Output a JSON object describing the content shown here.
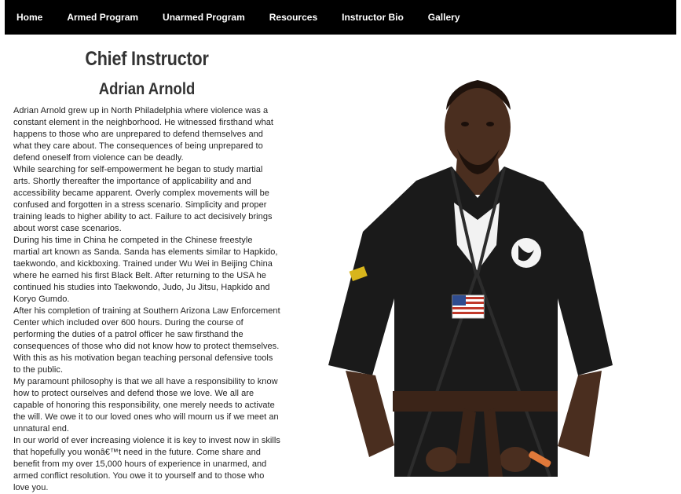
{
  "nav": {
    "items": [
      {
        "label": "Home"
      },
      {
        "label": "Armed Program"
      },
      {
        "label": "Unarmed Program"
      },
      {
        "label": "Resources"
      },
      {
        "label": "Instructor Bio"
      },
      {
        "label": "Gallery"
      }
    ]
  },
  "header": {
    "title": "Chief Instructor",
    "name": "Adrian Arnold"
  },
  "bio": {
    "paragraphs": [
      "Adrian Arnold grew up in North Philadelphia where violence was a constant element in the neighborhood. He witnessed firsthand what happens to those who are unprepared to defend themselves and what they care about. The consequences of being unprepared to defend oneself from violence can be deadly.",
      "While searching for self-empowerment he began to study martial arts. Shortly thereafter the importance of applicability and and accessibility became apparent. Overly complex movements will be confused and forgotten in a stress scenario. Simplicity and proper training leads to higher ability to act. Failure to act decisively brings about worst case scenarios.",
      "During his time in China he competed in the Chinese freestyle martial art known as Sanda. Sanda has elements similar to Hapkido, taekwondo, and kickboxing. Trained under Wu Wei in Beijing China where he earned his first Black Belt. After returning to the USA he continued his studies into Taekwondo, Judo, Ju Jitsu, Hapkido and Koryo Gumdo.",
      "After his completion of training at Southern Arizona Law Enforcement Center which included over 600 hours. During the course of performing the duties of a patrol officer he saw firsthand the consequences of those who did not know how to protect themselves. With this as his motivation began teaching personal defensive tools to the public.",
      "My paramount philosophy is that we all have a responsibility to know how to protect ourselves and defend those we love. We all are capable of honoring this responsibility, one merely needs to activate the will. We owe it to our loved ones who will mourn us if we meet an unnatural end.",
      "In our world of ever increasing violence it is key to invest now in skills that hopefully you wonâ€™t need in the future. Come share and benefit from my over 15,000 hours of experience in unarmed, and armed conflict resolution. You owe it to yourself and to those who love you."
    ]
  },
  "photo": {
    "icon": "instructor-portrait"
  },
  "colors": {
    "nav_bg": "#000000",
    "nav_text": "#ffffff",
    "heading": "#333333",
    "body_text": "#222222"
  }
}
